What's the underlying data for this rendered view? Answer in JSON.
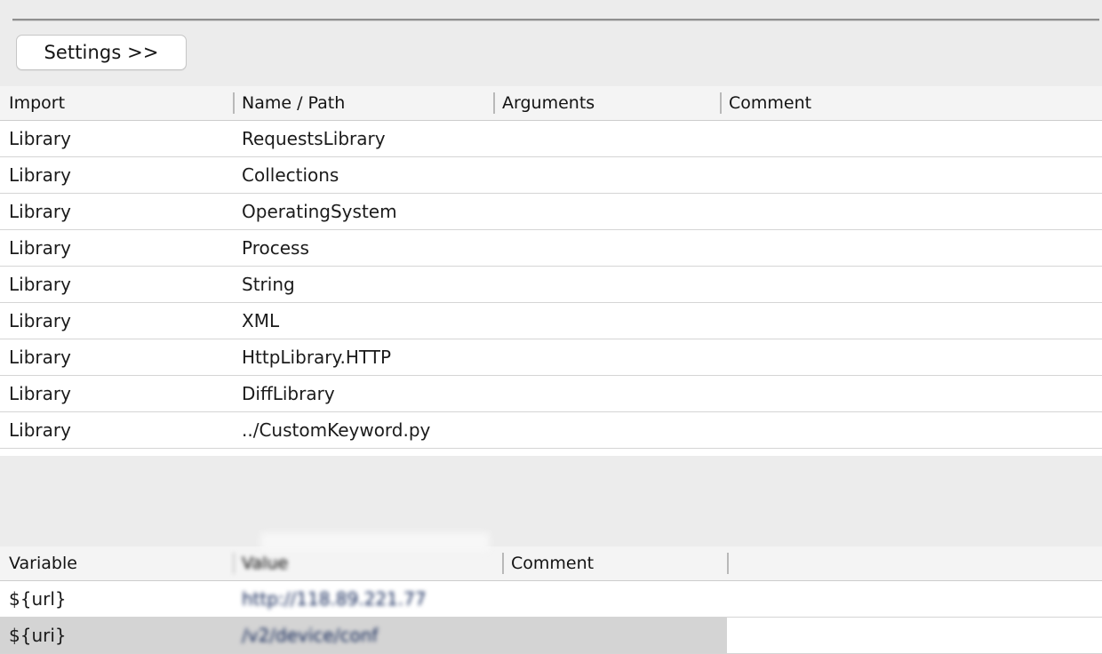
{
  "toolbar": {
    "settings_label": "Settings >>"
  },
  "imports_table": {
    "columns": [
      "Import",
      "Name / Path",
      "Arguments",
      "Comment"
    ],
    "rows": [
      {
        "import": "Library",
        "name": "RequestsLibrary",
        "arguments": "",
        "comment": ""
      },
      {
        "import": "Library",
        "name": "Collections",
        "arguments": "",
        "comment": ""
      },
      {
        "import": "Library",
        "name": "OperatingSystem",
        "arguments": "",
        "comment": ""
      },
      {
        "import": "Library",
        "name": "Process",
        "arguments": "",
        "comment": ""
      },
      {
        "import": "Library",
        "name": "String",
        "arguments": "",
        "comment": ""
      },
      {
        "import": "Library",
        "name": "XML",
        "arguments": "",
        "comment": ""
      },
      {
        "import": "Library",
        "name": "HttpLibrary.HTTP",
        "arguments": "",
        "comment": ""
      },
      {
        "import": "Library",
        "name": "DiffLibrary",
        "arguments": "",
        "comment": ""
      },
      {
        "import": "Library",
        "name": "../CustomKeyword.py",
        "arguments": "",
        "comment": ""
      },
      {
        "import": "",
        "name": "",
        "arguments": "",
        "comment": ""
      }
    ]
  },
  "variables_table": {
    "columns": [
      "Variable",
      "Value",
      "Comment",
      ""
    ],
    "rows": [
      {
        "variable": "${url}",
        "value": "http://118.89.221.77",
        "comment": "",
        "extra": "",
        "selected": false
      },
      {
        "variable": "${uri}",
        "value": "/v2/device/conf",
        "comment": "",
        "extra": "",
        "selected": true
      }
    ]
  },
  "colors": {
    "page_background": "#ececec",
    "grid_background": "#ffffff",
    "header_background": "#f4f4f4",
    "row_border": "#d5d5d5",
    "selection": "#d4d4d4",
    "text": "#1b1b1b",
    "divider": "#c3c3c3",
    "rule": "#8f8f8f"
  }
}
